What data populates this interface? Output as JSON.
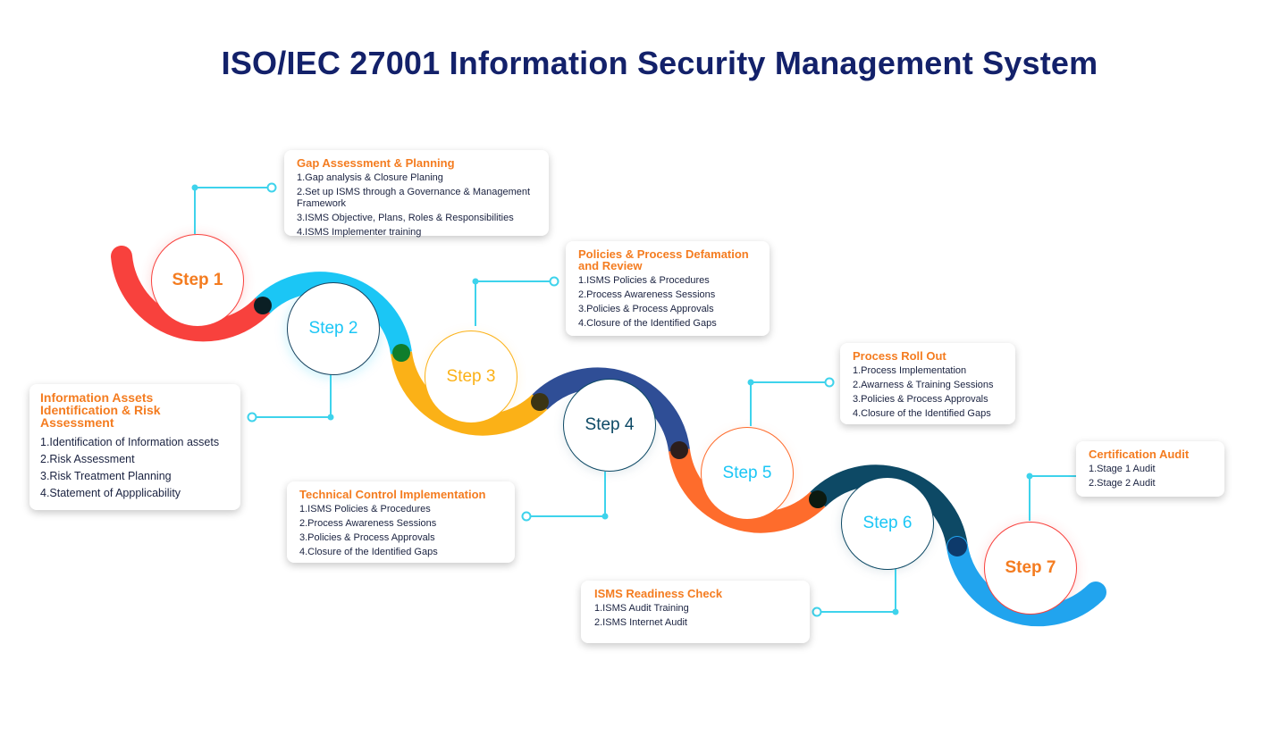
{
  "title": "ISO/IEC 27001 Information Security Management System",
  "colors": {
    "title": "#13216a",
    "heading": "#f47c20",
    "arc1": "#f8413d",
    "arc2": "#1bc6f5",
    "arc3": "#fbb117",
    "arc4": "#2f4e96",
    "arc5": "#fe6c2c",
    "arc6": "#0d4965",
    "arc7": "#21a4ee",
    "connector": "#3ed3ec"
  },
  "steps": [
    {
      "label": "Step 1",
      "color": "#f47c20",
      "ring": "#f8413d"
    },
    {
      "label": "Step 2",
      "color": "#1bc6f5",
      "ring": "#1a4460"
    },
    {
      "label": "Step 3",
      "color": "#fbb117",
      "ring": "#fbb117"
    },
    {
      "label": "Step 4",
      "color": "#0d4965",
      "ring": "#0d4965"
    },
    {
      "label": "Step 5",
      "color": "#1bc6f5",
      "ring": "#fe6c2c"
    },
    {
      "label": "Step 6",
      "color": "#1bc6f5",
      "ring": "#0d4965"
    },
    {
      "label": "Step 7",
      "color": "#f47c20",
      "ring": "#f8413d"
    }
  ],
  "cards": {
    "gap": {
      "title": "Gap Assessment & Planning",
      "items": [
        "1.Gap analysis & Closure Planing",
        "2.Set up ISMS through a Governance & Management Framework",
        "3.ISMS Objective, Plans, Roles & Responsibilities",
        "4.ISMS Implementer training"
      ]
    },
    "assets": {
      "title": "Information Assets Identification & Risk Assessment",
      "items": [
        "1.Identification of Information assets",
        "2.Risk Assessment",
        "3.Risk Treatment Planning",
        "4.Statement of Appplicability"
      ]
    },
    "policies": {
      "title": "Policies & Process Defamation and Review",
      "items": [
        "1.ISMS Policies & Procedures",
        "2.Process Awareness Sessions",
        "3.Policies & Process Approvals",
        "4.Closure of the Identified Gaps"
      ]
    },
    "technical": {
      "title": "Technical Control Implementation",
      "items": [
        "1.ISMS Policies & Procedures",
        "2.Process Awareness Sessions",
        "3.Policies & Process Approvals",
        "4.Closure of the Identified Gaps"
      ]
    },
    "rollout": {
      "title": "Process Roll Out",
      "items": [
        "1.Process Implementation",
        "2.Awarness & Training Sessions",
        "3.Policies & Process Approvals",
        "4.Closure of the Identified Gaps"
      ]
    },
    "readiness": {
      "title": "ISMS Readiness Check",
      "items": [
        "1.ISMS Audit Training",
        "2.ISMS Internet Audit"
      ]
    },
    "certification": {
      "title": "Certification Audit",
      "items": [
        "1.Stage 1 Audit",
        "2.Stage 2 Audit"
      ]
    }
  }
}
